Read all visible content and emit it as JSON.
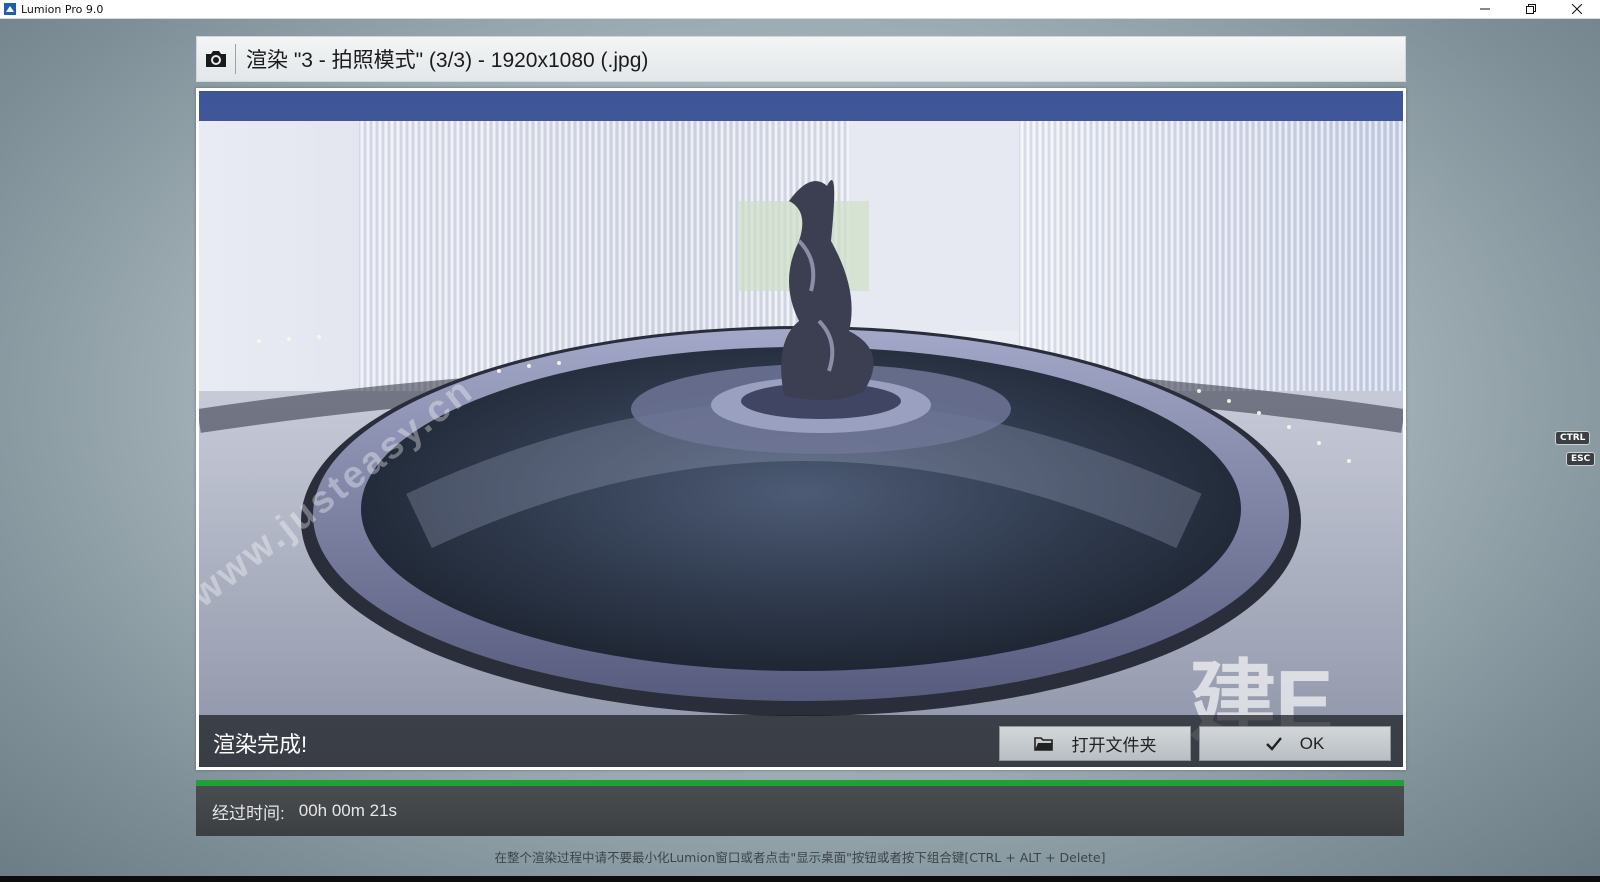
{
  "window": {
    "title": "Lumion Pro 9.0",
    "controls": [
      "minimize-icon",
      "restore-icon",
      "close-icon"
    ]
  },
  "header": {
    "icon": "camera-icon",
    "title": "渲染 \"3 - 拍照模式\" (3/3) - 1920x1080 (.jpg)"
  },
  "render": {
    "status": "渲染完成!",
    "open_folder_label": "打开文件夹",
    "open_folder_icon": "folder-icon",
    "ok_label": "OK",
    "ok_icon": "checkmark-icon"
  },
  "progress": {
    "fraction": 1.0,
    "color": "#22a038"
  },
  "elapsed": {
    "label": "经过时间:",
    "value": "00h 00m 21s"
  },
  "hint": "在整个渲染过程中请不要最小化Lumion窗口或者点击\"显示桌面\"按钮或者按下组合键[CTRL + ALT + Delete]",
  "keys": {
    "ctrl": "CTRL",
    "esc": "ESC"
  },
  "watermarks": [
    "www.justeasy.cn",
    "建E网"
  ]
}
